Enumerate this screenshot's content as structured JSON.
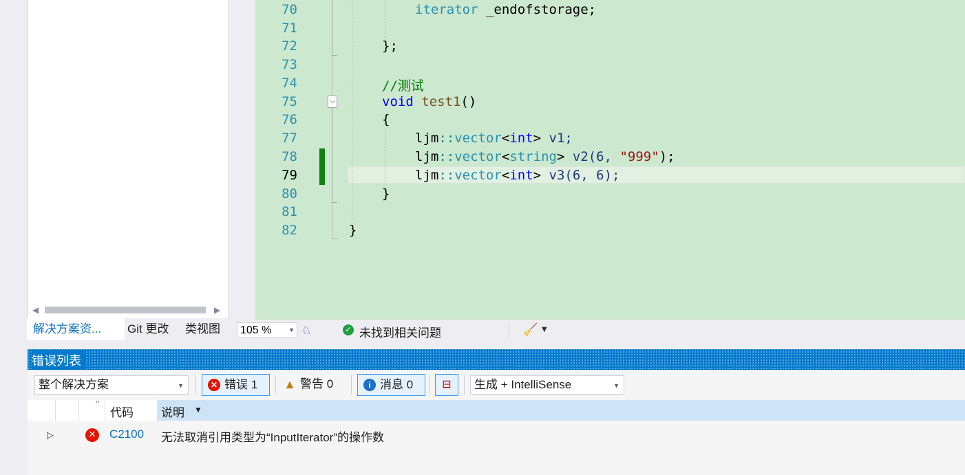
{
  "solution_explorer": {
    "tabs": [
      "解决方案资...",
      "Git 更改",
      "类视图"
    ]
  },
  "editor": {
    "line_numbers": [
      "70",
      "71",
      "72",
      "73",
      "74",
      "75",
      "76",
      "77",
      "78",
      "79",
      "80",
      "81",
      "82"
    ],
    "lines": {
      "l70": {
        "kw": "iterator",
        "rest": " _endofstorage;"
      },
      "l72": "};",
      "l74": "//测试",
      "l75": {
        "kw": "void",
        "fn": " test1",
        "rest": "()"
      },
      "l76": "{",
      "l77": {
        "ns": "ljm",
        "sep": "::",
        "ty": "vector",
        "lt": "<",
        "kw": "int",
        "gt": ">",
        "rest": " v1;"
      },
      "l78": {
        "ns": "ljm",
        "sep": "::",
        "ty": "vector",
        "lt": "<",
        "ty2": "string",
        "gt": ">",
        "var": " v2(6, ",
        "str": "\"999\"",
        "rest": ");"
      },
      "l79": {
        "ns": "ljm",
        "sep": "::",
        "ty": "vector",
        "lt": "<",
        "kw": "int",
        "gt": ">",
        "rest": " v3(6, 6);"
      },
      "l80": "}",
      "l82": "}"
    }
  },
  "editor_status": {
    "zoom": "105 %",
    "issues_text": "未找到相关问题"
  },
  "error_list": {
    "title": "错误列表",
    "scope": "整个解决方案",
    "errors_btn": "错误 1",
    "warnings_btn": "警告 0",
    "messages_btn": "消息 0",
    "build_filter": "生成 + IntelliSense",
    "columns": {
      "code": "代码",
      "description": "说明"
    },
    "rows": [
      {
        "code": "C2100",
        "description": "无法取消引用类型为“InputIterator”的操作数"
      }
    ]
  },
  "colors": {
    "editor_bg": "#cce8cf",
    "accent": "#007acc",
    "error": "#e51400",
    "change_marker": "#108010"
  }
}
